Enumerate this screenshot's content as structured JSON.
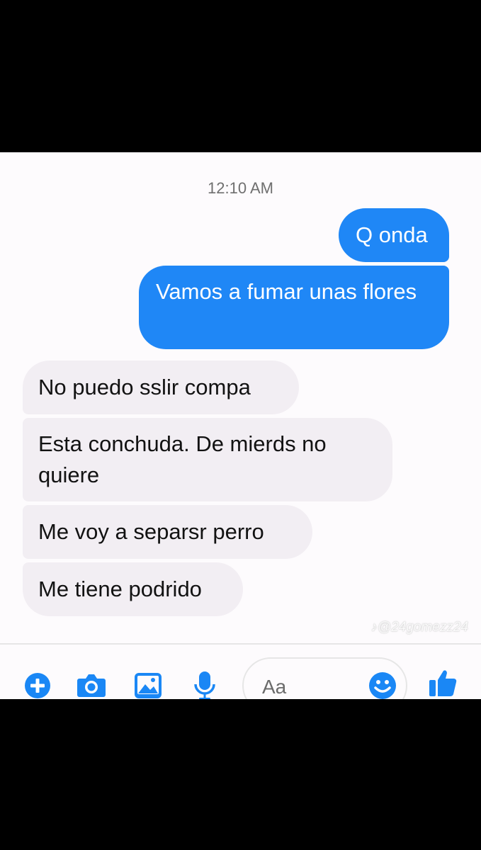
{
  "conversation": {
    "timestamp": "12:10 AM",
    "messages": [
      {
        "id": "m1",
        "direction": "outgoing",
        "text": "Q onda"
      },
      {
        "id": "m2",
        "direction": "outgoing",
        "text": "Vamos a fumar unas flores"
      },
      {
        "id": "m3",
        "direction": "incoming",
        "text": "No puedo sslir compa"
      },
      {
        "id": "m4",
        "direction": "incoming",
        "text": "Esta conchuda. De mierds no quiere"
      },
      {
        "id": "m5",
        "direction": "incoming",
        "text": "Me voy a separsr perro"
      },
      {
        "id": "m6",
        "direction": "incoming",
        "text": "Me tiene podrido"
      }
    ]
  },
  "watermark": {
    "icon": "tiktok-icon",
    "text": "@24gomezz24"
  },
  "composer": {
    "placeholder": "Aa",
    "icons": [
      "plus-icon",
      "camera-icon",
      "image-icon",
      "microphone-icon",
      "emoji-icon",
      "thumbs-up-icon"
    ]
  },
  "colors": {
    "outgoing_bubble": "#1f87f6",
    "incoming_bubble": "#f2eef3",
    "accent": "#1a87f5",
    "background": "#fdfbfd"
  }
}
